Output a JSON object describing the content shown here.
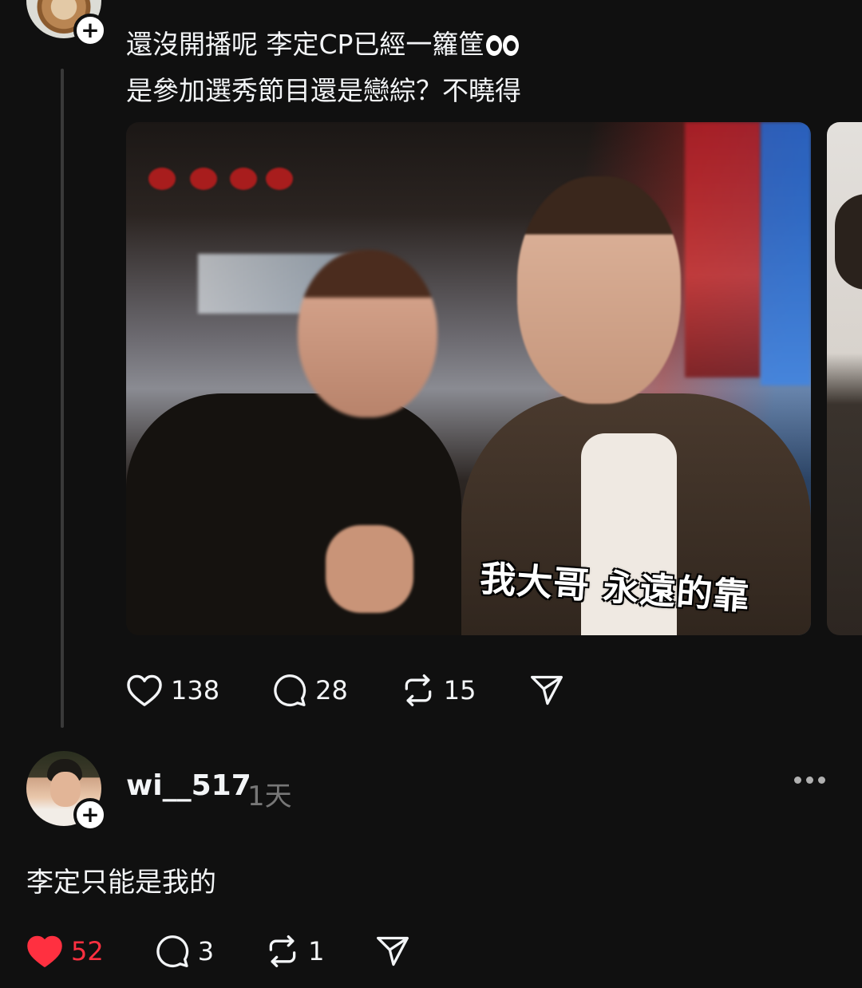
{
  "post": {
    "text_line1": "還沒開播呢 李定CP已經一籮筐",
    "text_line2": "是參加選秀節目還是戀綜？不曉得",
    "emoji": "eyes",
    "media_caption": "我大哥 永遠的靠",
    "actions": {
      "likes": "138",
      "comments": "28",
      "reposts": "15"
    }
  },
  "reply": {
    "username": "wi__517",
    "time": "1天",
    "text": "李定只能是我的",
    "actions": {
      "likes": "52",
      "comments": "3",
      "reposts": "1"
    },
    "liked": true
  },
  "colors": {
    "background": "#101010",
    "text": "#f3f5f7",
    "muted": "#777777",
    "like_active": "#ff3040",
    "thread_line": "#393939"
  },
  "icons": [
    "heart-icon",
    "comment-icon",
    "repost-icon",
    "share-icon",
    "plus-icon",
    "more-icon"
  ]
}
